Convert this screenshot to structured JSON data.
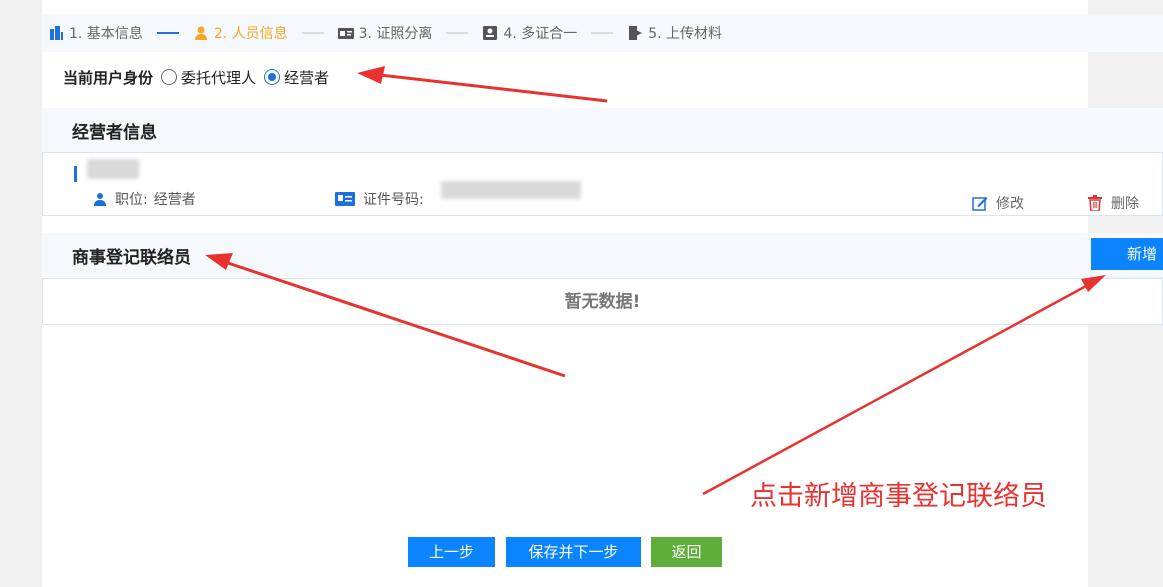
{
  "steps": [
    {
      "label": "1. 基本信息"
    },
    {
      "label": "2. 人员信息"
    },
    {
      "label": "3. 证照分离"
    },
    {
      "label": "4. 多证合一"
    },
    {
      "label": "5. 上传材料"
    }
  ],
  "identity": {
    "label": "当前用户身份",
    "options": [
      "委托代理人",
      "经营者"
    ],
    "selected": "经营者"
  },
  "operator_section": {
    "title": "经营者信息",
    "position_label": "职位:",
    "position_value": "经营者",
    "id_label": "证件号码:",
    "edit_label": "修改",
    "delete_label": "删除"
  },
  "liaison_section": {
    "title": "商事登记联络员",
    "add_label": "新增",
    "empty_text": "暂无数据!"
  },
  "footer": {
    "prev_label": "上一步",
    "save_next_label": "保存并下一步",
    "back_label": "返回"
  },
  "annotation": {
    "text": "点击新增商事登记联络员"
  },
  "colors": {
    "primary": "#1e6fe0",
    "add_button": "#0a84ff",
    "back_button": "#5fae3a",
    "active_step": "#f5a623",
    "annotation": "#e8322f",
    "delete_icon": "#e8322f"
  }
}
